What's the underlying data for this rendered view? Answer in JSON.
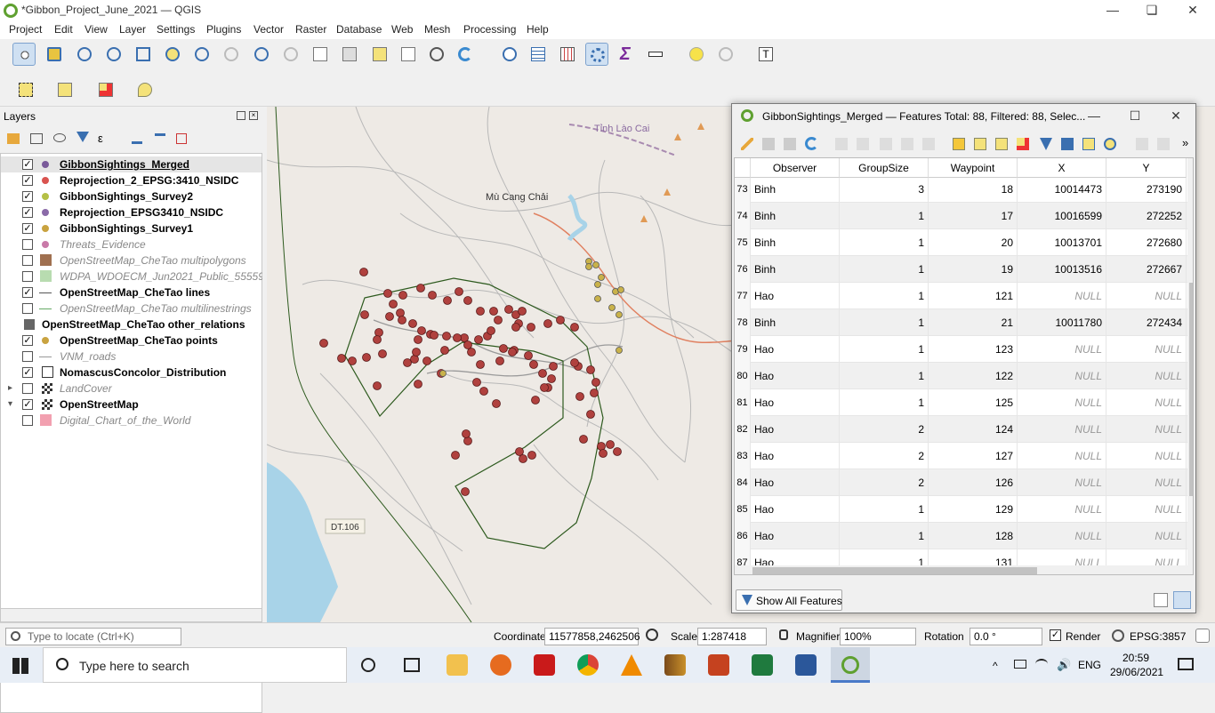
{
  "window": {
    "title": "*Gibbon_Project_June_2021 — QGIS"
  },
  "menu": [
    "Project",
    "Edit",
    "View",
    "Layer",
    "Settings",
    "Plugins",
    "Vector",
    "Raster",
    "Database",
    "Web",
    "Mesh",
    "Processing",
    "Help"
  ],
  "layers_panel": {
    "title": "Layers",
    "items": [
      {
        "name": "GibbonSightings_Merged",
        "checked": true,
        "style": "bold-underline",
        "color": "#7a5a9a"
      },
      {
        "name": "Reprojection_2_EPSG:3410_NSIDC",
        "checked": true,
        "style": "bold",
        "color": "#d9534f"
      },
      {
        "name": "GibbonSightings_Survey2",
        "checked": true,
        "style": "bold",
        "color": "#b5c046"
      },
      {
        "name": "Reprojection_EPSG3410_NSIDC",
        "checked": true,
        "style": "bold",
        "color": "#8a6aa8"
      },
      {
        "name": "GibbonSightings_Survey1",
        "checked": true,
        "style": "bold",
        "color": "#c9a340"
      },
      {
        "name": "Threats_Evidence",
        "checked": false,
        "style": "italic",
        "color": "#c97aa8"
      },
      {
        "name": "OpenStreetMap_CheTao multipolygons",
        "checked": false,
        "style": "italic",
        "color": "#a07050"
      },
      {
        "name": "WDPA_WDOECM_Jun2021_Public_55559",
        "checked": false,
        "style": "italic",
        "color": "#b8dcb0"
      },
      {
        "name": "OpenStreetMap_CheTao lines",
        "checked": true,
        "style": "bold",
        "color": "#555555"
      },
      {
        "name": "OpenStreetMap_CheTao multilinestrings",
        "checked": false,
        "style": "italic",
        "color": "#66aa66"
      },
      {
        "name": "OpenStreetMap_CheTao other_relations",
        "checked": null,
        "style": "bold",
        "color": "#666666"
      },
      {
        "name": "OpenStreetMap_CheTao points",
        "checked": true,
        "style": "bold",
        "color": "#c9a340"
      },
      {
        "name": "VNM_roads",
        "checked": false,
        "style": "italic",
        "color": "#999999"
      },
      {
        "name": "NomascusConcolor_Distribution",
        "checked": true,
        "style": "bold",
        "color": "#ffffff"
      },
      {
        "name": "LandCover",
        "checked": false,
        "style": "italic",
        "color": "#555555"
      },
      {
        "name": "OpenStreetMap",
        "checked": true,
        "style": "bold",
        "color": "#555555"
      },
      {
        "name": "Digital_Chart_of_the_World",
        "checked": false,
        "style": "italic",
        "color": "#f2a0b0"
      }
    ]
  },
  "map": {
    "labels": {
      "province": "Tỉnh Lào Cai",
      "town": "Mù Cang Chải",
      "road": "DT.106"
    }
  },
  "attribute_table": {
    "title": "GibbonSightings_Merged — Features Total: 88, Filtered: 88, Selec...",
    "columns": [
      "Observer",
      "GroupSize",
      "Waypoint",
      "X",
      "Y"
    ],
    "rows": [
      {
        "n": "73",
        "observer": "Binh",
        "group": "3",
        "waypoint": "18",
        "x": "10014473",
        "y": "273190"
      },
      {
        "n": "74",
        "observer": "Binh",
        "group": "1",
        "waypoint": "17",
        "x": "10016599",
        "y": "272252"
      },
      {
        "n": "75",
        "observer": "Binh",
        "group": "1",
        "waypoint": "20",
        "x": "10013701",
        "y": "272680"
      },
      {
        "n": "76",
        "observer": "Binh",
        "group": "1",
        "waypoint": "19",
        "x": "10013516",
        "y": "272667"
      },
      {
        "n": "77",
        "observer": "Hao",
        "group": "1",
        "waypoint": "121",
        "x": "NULL",
        "y": "NULL"
      },
      {
        "n": "78",
        "observer": "Binh",
        "group": "1",
        "waypoint": "21",
        "x": "10011780",
        "y": "272434"
      },
      {
        "n": "79",
        "observer": "Hao",
        "group": "1",
        "waypoint": "123",
        "x": "NULL",
        "y": "NULL"
      },
      {
        "n": "80",
        "observer": "Hao",
        "group": "1",
        "waypoint": "122",
        "x": "NULL",
        "y": "NULL"
      },
      {
        "n": "81",
        "observer": "Hao",
        "group": "1",
        "waypoint": "125",
        "x": "NULL",
        "y": "NULL"
      },
      {
        "n": "82",
        "observer": "Hao",
        "group": "2",
        "waypoint": "124",
        "x": "NULL",
        "y": "NULL"
      },
      {
        "n": "83",
        "observer": "Hao",
        "group": "2",
        "waypoint": "127",
        "x": "NULL",
        "y": "NULL"
      },
      {
        "n": "84",
        "observer": "Hao",
        "group": "2",
        "waypoint": "126",
        "x": "NULL",
        "y": "NULL"
      },
      {
        "n": "85",
        "observer": "Hao",
        "group": "1",
        "waypoint": "129",
        "x": "NULL",
        "y": "NULL"
      },
      {
        "n": "86",
        "observer": "Hao",
        "group": "1",
        "waypoint": "128",
        "x": "NULL",
        "y": "NULL"
      },
      {
        "n": "87",
        "observer": "Hao",
        "group": "1",
        "waypoint": "131",
        "x": "NULL",
        "y": "NULL"
      }
    ],
    "show_all_label": "Show All Features"
  },
  "statusbar": {
    "locate_placeholder": "Type to locate (Ctrl+K)",
    "coordinate_label": "Coordinate",
    "coordinate": "11577858,2462506",
    "scale_label": "Scale",
    "scale": "1:287418",
    "magnifier_label": "Magnifier",
    "magnifier": "100%",
    "rotation_label": "Rotation",
    "rotation": "0.0 °",
    "render_label": "Render",
    "crs": "EPSG:3857"
  },
  "taskbar": {
    "search_placeholder": "Type here to search",
    "lang": "ENG",
    "time": "20:59",
    "date": "29/06/2021"
  },
  "colors": {
    "sighting": "#b0413e",
    "polygon": "#2d5a1e",
    "water": "#a8d3e8"
  }
}
